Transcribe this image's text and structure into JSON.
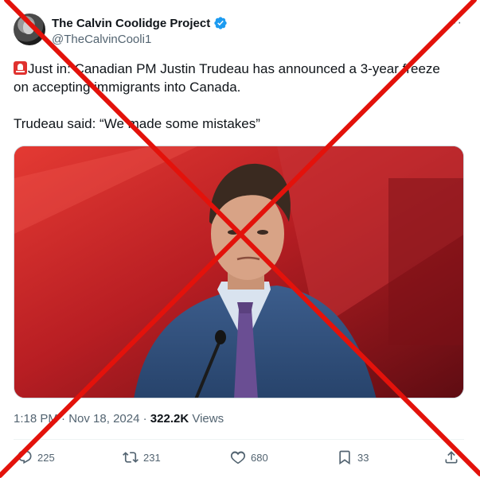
{
  "account": {
    "display_name": "The Calvin Coolidge Project",
    "handle": "@TheCalvinCooli1",
    "verified": true
  },
  "tweet": {
    "line1_prefix": "Just in: Canadian PM Justin Trudeau has announced a 3-year freeze",
    "line1_suffix": "on accepting immigrants into Canada.",
    "line2": "Trudeau said: “We made some mistakes”"
  },
  "meta": {
    "time": "1:18 PM",
    "date": "Nov 18, 2024",
    "separator": "·",
    "views_count": "322.2K",
    "views_label": "Views"
  },
  "actions": {
    "replies": "225",
    "reposts": "231",
    "likes": "680",
    "bookmarks": "33"
  },
  "colors": {
    "text_primary": "#0f1419",
    "text_secondary": "#536471",
    "verified_blue": "#1d9bf0",
    "cross_red": "#e3120b"
  },
  "icons": [
    "verified-badge-icon",
    "more-icon",
    "siren-emoji-icon",
    "reply-icon",
    "repost-icon",
    "like-icon",
    "bookmark-icon",
    "share-icon"
  ]
}
